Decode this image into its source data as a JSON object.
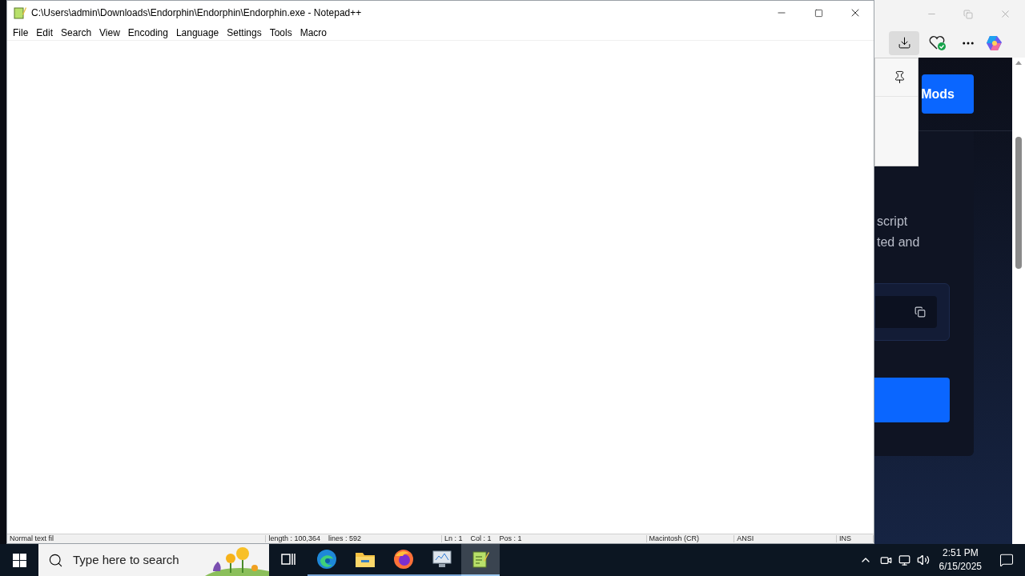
{
  "notepad": {
    "title": "C:\\Users\\admin\\Downloads\\Endorphin\\Endorphin\\Endorphin.exe - Notepad++",
    "menu": [
      "File",
      "Edit",
      "Search",
      "View",
      "Encoding",
      "Language",
      "Settings",
      "Tools",
      "Macro"
    ],
    "status_bar": [
      "Normal text fil",
      "length : 100,364    lines : 592",
      "Ln : 1    Col : 1    Pos : 1",
      "Macintosh (CR)",
      "ANSI",
      "INS"
    ]
  },
  "browser": {
    "page": {
      "header_button": "Mods",
      "text_lines": [
        "script",
        "ted and"
      ]
    }
  },
  "taskbar": {
    "search_placeholder": "Type here to search",
    "apps": [
      {
        "kind": "taskview",
        "selected": false
      },
      {
        "kind": "edge",
        "selected": false
      },
      {
        "kind": "explorer",
        "selected": false
      },
      {
        "kind": "firefox",
        "selected": false
      },
      {
        "kind": "monitor",
        "selected": false
      },
      {
        "kind": "notepad",
        "selected": true
      }
    ],
    "clock": {
      "time": "2:51 PM",
      "date": "6/15/2025"
    }
  }
}
